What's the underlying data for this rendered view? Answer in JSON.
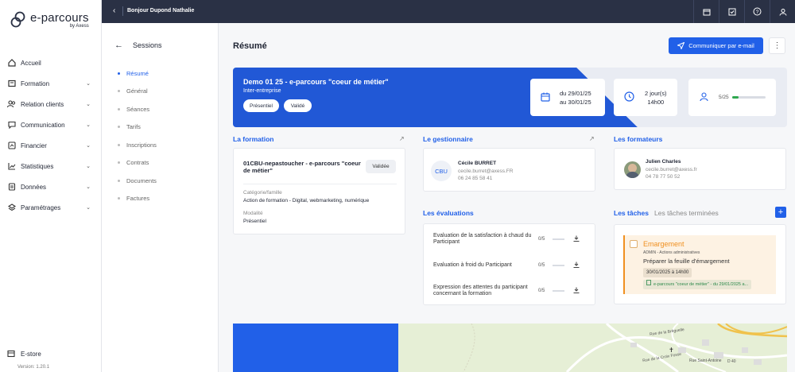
{
  "app": {
    "logo_title": "e-parcours",
    "logo_sub": "by Axess",
    "greeting": "Bonjour Dupond Nathalie",
    "version": "Version: 1.20.1"
  },
  "nav": {
    "items": [
      {
        "label": "Accueil",
        "icon": "home-icon",
        "chevron": false
      },
      {
        "label": "Formation",
        "icon": "book-icon",
        "chevron": true
      },
      {
        "label": "Relation clients",
        "icon": "users-icon",
        "chevron": true
      },
      {
        "label": "Communication",
        "icon": "chat-icon",
        "chevron": true
      },
      {
        "label": "Financier",
        "icon": "money-icon",
        "chevron": true
      },
      {
        "label": "Statistiques",
        "icon": "chart-icon",
        "chevron": true
      },
      {
        "label": "Données",
        "icon": "file-icon",
        "chevron": true
      },
      {
        "label": "Paramétrages",
        "icon": "layers-icon",
        "chevron": true
      }
    ],
    "estore": "E-store"
  },
  "subnav": {
    "title": "Sessions",
    "items": [
      "Résumé",
      "Général",
      "Séances",
      "Tarifs",
      "Inscriptions",
      "Contrats",
      "Documents",
      "Factures"
    ],
    "active_index": 0
  },
  "main": {
    "title": "Résumé",
    "mail_button": "Communiquer par e-mail",
    "hero": {
      "title": "Demo 01 25 - e-parcours \"coeur de métier\"",
      "subtitle": "Inter-entreprise",
      "chips": [
        "Présentiel",
        "Validé"
      ],
      "dates_line1": "du 29/01/25",
      "dates_line2": "au 30/01/25",
      "duration_line1": "2 jour(s)",
      "duration_line2": "14h00",
      "participants": "5/25",
      "participants_fraction": 0.2
    },
    "formation": {
      "section": "La formation",
      "title": "01CBU-nepastoucher - e-parcours \"coeur de métier\"",
      "status": "Validée",
      "category_label": "Catégorie/famille",
      "category_value": "Action de formation - Digital, webmarketing, numérique",
      "modality_label": "Modalité",
      "modality_value": "Présentiel"
    },
    "manager": {
      "section": "Le gestionnaire",
      "initials": "CBU",
      "name": "Cécile BURRET",
      "email": "cecile.burret@axess.FR",
      "phone": "06 24 85 58 41"
    },
    "trainers": {
      "section": "Les formateurs",
      "name": "Julien Charles",
      "email": "cecile.burret@axess.fr",
      "phone": "04 78 77 50 52"
    },
    "evaluations": {
      "section": "Les évaluations",
      "rows": [
        {
          "label": "Evaluation de la satisfaction à chaud du Participant",
          "count": "0/5"
        },
        {
          "label": "Evaluation à froid du Participant",
          "count": "0/5"
        },
        {
          "label": "Expression des attentes du participant concernant la formation",
          "count": "0/5"
        }
      ]
    },
    "tasks": {
      "tab_active": "Les tâches",
      "tab_inactive": "Les tâches terminées",
      "task_title": "Emargement",
      "task_meta": "ADMIN - Actions administratives",
      "task_desc": "Préparer la feuille d'émargement",
      "task_date": "30/01/2025 à 14h00",
      "task_link": "e-parcours \"coeur de métier\" - du 29/01/2025 a..."
    },
    "map": {
      "labels": [
        "Rue de la Bréguelle",
        "Rue Saint-Antoine",
        "Rue de la Croix Fosse",
        "D 40"
      ]
    }
  },
  "colors": {
    "accent": "#2160e8",
    "topbar": "#2a3145",
    "task_orange": "#f09020"
  }
}
